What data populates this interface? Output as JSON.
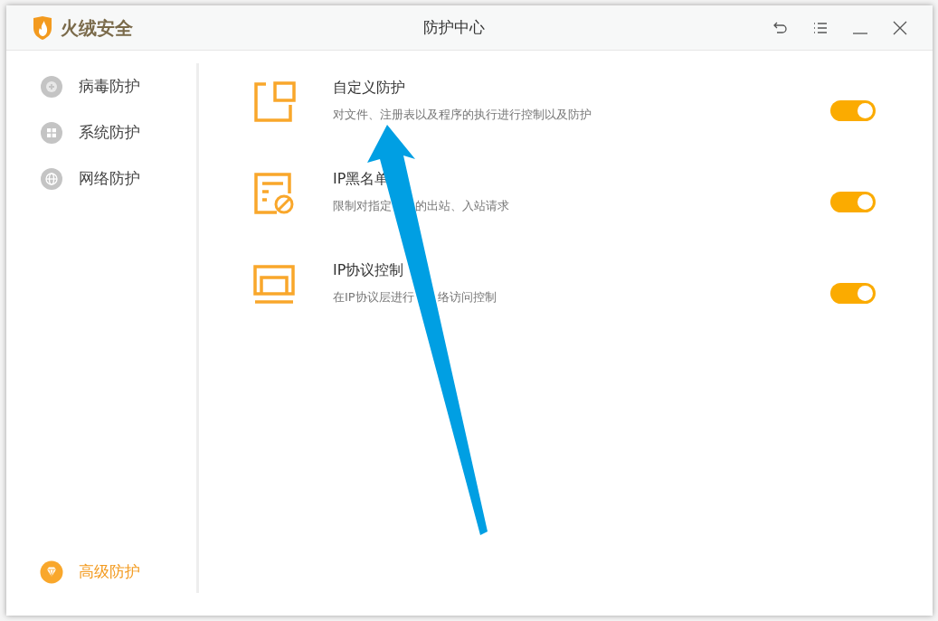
{
  "window": {
    "logo_text": "火绒安全",
    "title": "防护中心"
  },
  "title_buttons": [
    {
      "kind": "back"
    },
    {
      "kind": "menu"
    },
    {
      "kind": "minimize"
    },
    {
      "kind": "close"
    }
  ],
  "sidebar": {
    "items": [
      {
        "label": "病毒防护",
        "kind": "virus",
        "selected": false
      },
      {
        "label": "系统防护",
        "kind": "system",
        "selected": false
      },
      {
        "label": "网络防护",
        "kind": "network",
        "selected": false
      }
    ],
    "premium_item": {
      "label": "高级防护"
    }
  },
  "features": [
    {
      "kind": "custom",
      "title": "自定义防护",
      "description_parts": [
        "对文件、注册表以及程序的执行进行控制以及防护"
      ],
      "on": true
    },
    {
      "kind": "blacklist",
      "title": "IP黑名单",
      "description_parts": [
        "限制对指定",
        "的出站、入站请求"
      ],
      "on": true
    },
    {
      "kind": "protocol",
      "title": "IP协议控制",
      "description_parts": [
        "在IP协议层进行",
        "络访问控制"
      ],
      "on": true
    }
  ],
  "annotation": {
    "kind": "arrow"
  }
}
